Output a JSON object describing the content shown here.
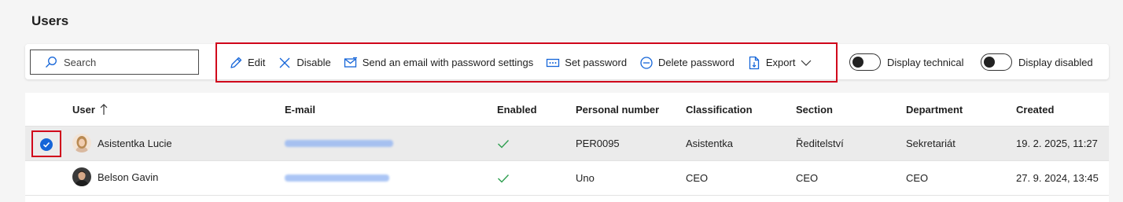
{
  "page": {
    "title": "Users"
  },
  "search": {
    "placeholder": "Search"
  },
  "toolbar": {
    "actions": [
      {
        "label": "Edit",
        "icon": "pencil-icon"
      },
      {
        "label": "Disable",
        "icon": "x-icon"
      },
      {
        "label": "Send an email with password settings",
        "icon": "email-send-icon"
      },
      {
        "label": "Set password",
        "icon": "password-dots-icon"
      },
      {
        "label": "Delete password",
        "icon": "minus-circle-icon"
      },
      {
        "label": "Export",
        "icon": "file-export-icon"
      }
    ],
    "toggles": [
      {
        "label": "Display technical",
        "on": false
      },
      {
        "label": "Display disabled",
        "on": false
      }
    ]
  },
  "table": {
    "columns": [
      "User",
      "E-mail",
      "Enabled",
      "Personal number",
      "Classification",
      "Section",
      "Department",
      "Created"
    ],
    "sort": {
      "column": "User",
      "direction": "ascending"
    },
    "rows": [
      {
        "selected": true,
        "user": "Asistentka Lucie",
        "enabled": true,
        "personal_number": "PER0095",
        "classification": "Asistentka",
        "section": "Ředitelství",
        "department": "Sekretariát",
        "created": "19. 2. 2025, 11:27"
      },
      {
        "selected": false,
        "user": "Belson Gavin",
        "enabled": true,
        "personal_number": "Uno",
        "classification": "CEO",
        "section": "CEO",
        "department": "CEO",
        "created": "27. 9. 2024, 13:45"
      }
    ]
  },
  "colors": {
    "accent": "#1565d8",
    "highlight_border": "#d0021b",
    "check": "#2e9e4f"
  }
}
